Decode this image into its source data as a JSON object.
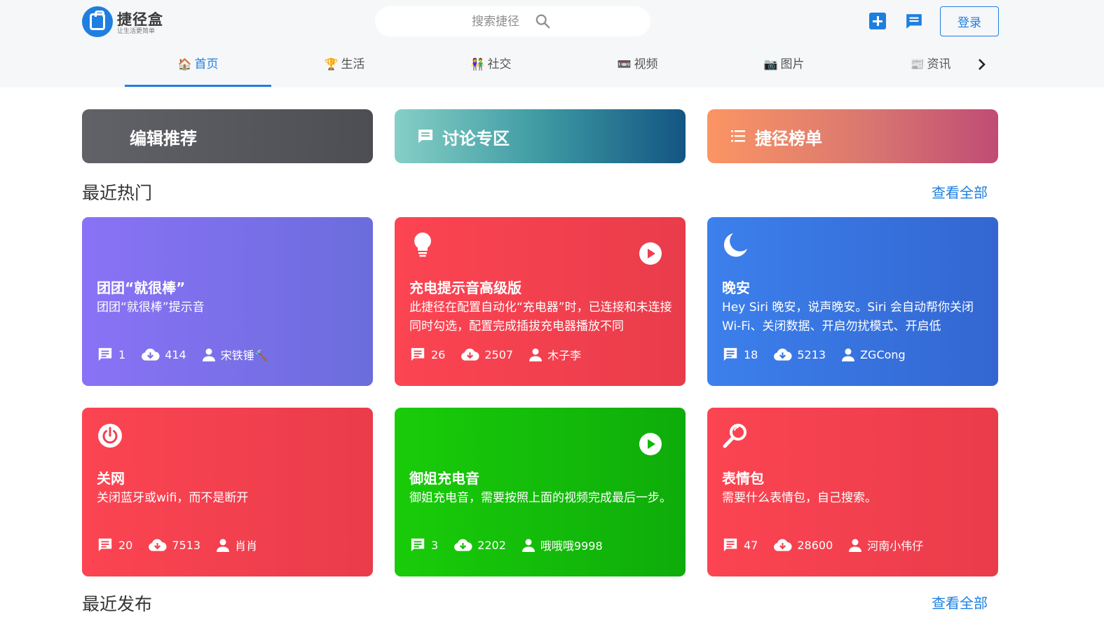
{
  "header": {
    "logo_name": "捷径盒",
    "logo_slogan": "让生活更简单",
    "search_placeholder": "搜索捷径",
    "login_label": "登录"
  },
  "tabs": [
    {
      "icon": "🏠",
      "label": "首页",
      "active": true
    },
    {
      "icon": "🏆",
      "label": "生活"
    },
    {
      "icon": "👫",
      "label": "社交"
    },
    {
      "icon": "📼",
      "label": "视频"
    },
    {
      "icon": "📷",
      "label": "图片"
    },
    {
      "icon": "📰",
      "label": "资讯"
    }
  ],
  "banners": [
    {
      "label": "编辑推荐"
    },
    {
      "label": "讨论专区",
      "icon": "message-icon"
    },
    {
      "label": "捷径榜单",
      "icon": "list-icon"
    }
  ],
  "sections": {
    "hot_title": "最近热门",
    "recent_title": "最近发布",
    "more_label": "查看全部"
  },
  "cards": [
    {
      "title": "团团“就很棒”",
      "desc": "团团“就很棒”提示音",
      "comments": "1",
      "downloads": "414",
      "author": "宋铁锤🔨",
      "color": "#8a72f6",
      "icon": "none",
      "video": false
    },
    {
      "title": "充电提示音高级版",
      "desc": "此捷径在配置自动化“充电器”时，已连接和未连接同时勾选，配置完成插拔充电器播放不同",
      "comments": "26",
      "downloads": "2507",
      "author": "木子李",
      "color": "#fc4452",
      "icon": "lightbulb-icon",
      "video": true
    },
    {
      "title": "晚安",
      "desc": "Hey Siri 晚安，说声晚安。Siri 会自动帮你关闭Wi-Fi、关闭数据、开启勿扰模式、开启低",
      "comments": "18",
      "downloads": "5213",
      "author": "ZGCong",
      "color": "#3c80ec",
      "icon": "moon-icon",
      "video": false
    },
    {
      "title": "关网",
      "desc": "关闭蓝牙或wifi，而不是断开",
      "comments": "20",
      "downloads": "7513",
      "author": "肖肖",
      "color": "#fc4452",
      "icon": "power-icon",
      "video": false
    },
    {
      "title": "御姐充电音",
      "desc": "御姐充电音，需要按照上面的视频完成最后一步。",
      "comments": "3",
      "downloads": "2202",
      "author": "哦哦哦9998",
      "color": "#19cc09",
      "icon": "none",
      "video": true
    },
    {
      "title": "表情包",
      "desc": "需要什么表情包，自己搜索。",
      "comments": "47",
      "downloads": "28600",
      "author": "河南小伟仔",
      "color": "#fc4452",
      "icon": "magnifier-icon",
      "video": false
    }
  ]
}
